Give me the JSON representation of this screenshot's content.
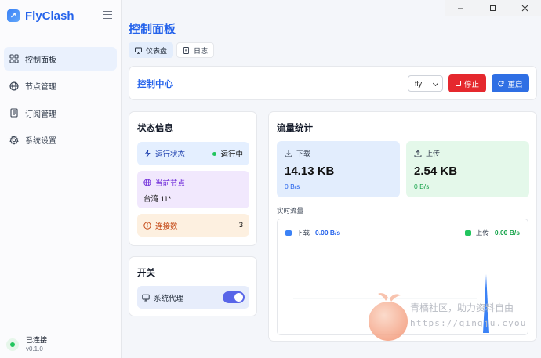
{
  "app": {
    "name": "FlyClash",
    "logo_glyph": "↗"
  },
  "sidebar": {
    "items": [
      {
        "label": "控制面板",
        "icon": "dashboard-icon",
        "active": true
      },
      {
        "label": "节点管理",
        "icon": "globe-icon",
        "active": false
      },
      {
        "label": "订阅管理",
        "icon": "document-icon",
        "active": false
      },
      {
        "label": "系统设置",
        "icon": "gear-icon",
        "active": false
      }
    ],
    "status": {
      "label": "已连接",
      "version": "v0.1.0"
    }
  },
  "page": {
    "title": "控制面板",
    "tabs": [
      {
        "label": "仪表盘",
        "icon": "monitor-icon",
        "active": true
      },
      {
        "label": "日志",
        "icon": "log-icon",
        "active": false
      }
    ]
  },
  "control": {
    "title": "控制中心",
    "select_value": "fly",
    "stop_label": "停止",
    "restart_label": "重启"
  },
  "status": {
    "title": "状态信息",
    "running_label": "运行状态",
    "running_value": "运行中",
    "node_label": "当前节点",
    "node_value": "台湾 11*",
    "connections_label": "连接数",
    "connections_value": "3"
  },
  "switches": {
    "title": "开关",
    "system_proxy_label": "系统代理",
    "system_proxy_on": true
  },
  "traffic": {
    "title": "流量统计",
    "download_label": "下载",
    "download_total": "14.13 KB",
    "download_rate": "0 B/s",
    "upload_label": "上传",
    "upload_total": "2.54 KB",
    "upload_rate": "0 B/s",
    "realtime_label": "实时流量",
    "legend_download": "下载",
    "legend_download_value": "0.00 B/s",
    "legend_upload": "上传",
    "legend_upload_value": "0.00 B/s"
  },
  "colors": {
    "accent": "#2563eb",
    "stop": "#e5282e",
    "restart": "#2f6fe4",
    "download": "#3b82f6",
    "upload": "#22c55e",
    "toggle": "#5865e8"
  },
  "watermark": {
    "line1": "青橘社区，助力资料自由",
    "line2": "https://qingju.cyou"
  }
}
